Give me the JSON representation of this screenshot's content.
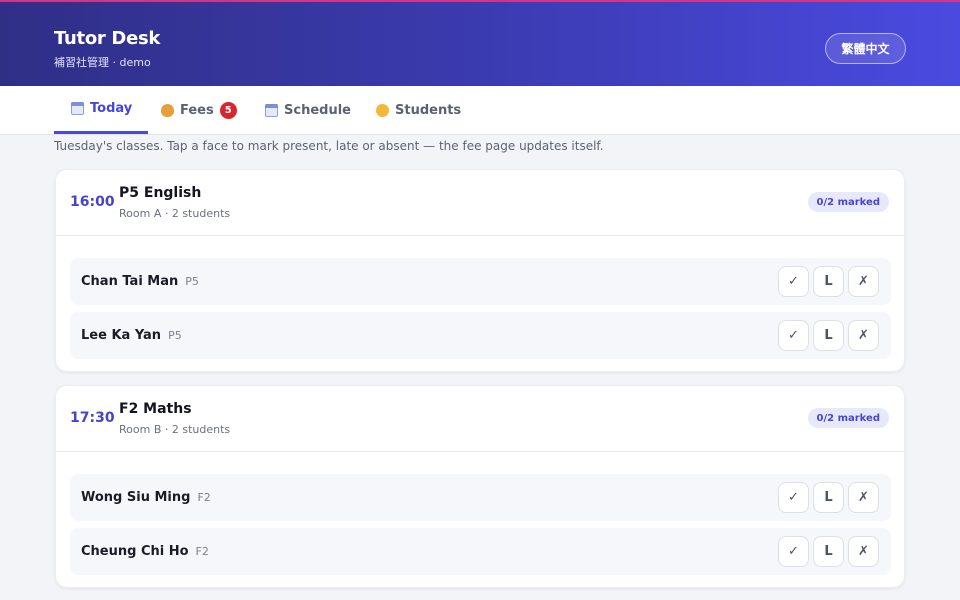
{
  "app": {
    "title": "Tutor Desk",
    "subtitle": "補習社管理 · demo",
    "lang_button": "繁體中文"
  },
  "tabs": [
    {
      "label": "Today",
      "icon": "calendar-icon",
      "active": true
    },
    {
      "label": "Fees",
      "icon": "money-bag-icon",
      "badge": "5"
    },
    {
      "label": "Schedule",
      "icon": "calendar-icon"
    },
    {
      "label": "Students",
      "icon": "face-icon"
    }
  ],
  "hint": "Tuesday's classes. Tap a face to mark present, late or absent — the fee page updates itself.",
  "classes": [
    {
      "time": "16:00",
      "title": "P5 English",
      "meta": "Room A · 2 students",
      "marked": "0/2 marked",
      "students": [
        {
          "name": "Chan Tai Man",
          "grade": "P5"
        },
        {
          "name": "Lee Ka Yan",
          "grade": "P5"
        }
      ]
    },
    {
      "time": "17:30",
      "title": "F2 Maths",
      "meta": "Room B · 2 students",
      "marked": "0/2 marked",
      "students": [
        {
          "name": "Wong Siu Ming",
          "grade": "F2"
        },
        {
          "name": "Cheung Chi Ho",
          "grade": "F2"
        }
      ]
    }
  ],
  "marks": {
    "present": "✓",
    "late": "L",
    "absent": "✗"
  },
  "colors": {
    "accent": "#4a4ad8",
    "header_start": "#2f2f86",
    "header_end": "#4a4ae0",
    "badge": "#d9262c"
  }
}
